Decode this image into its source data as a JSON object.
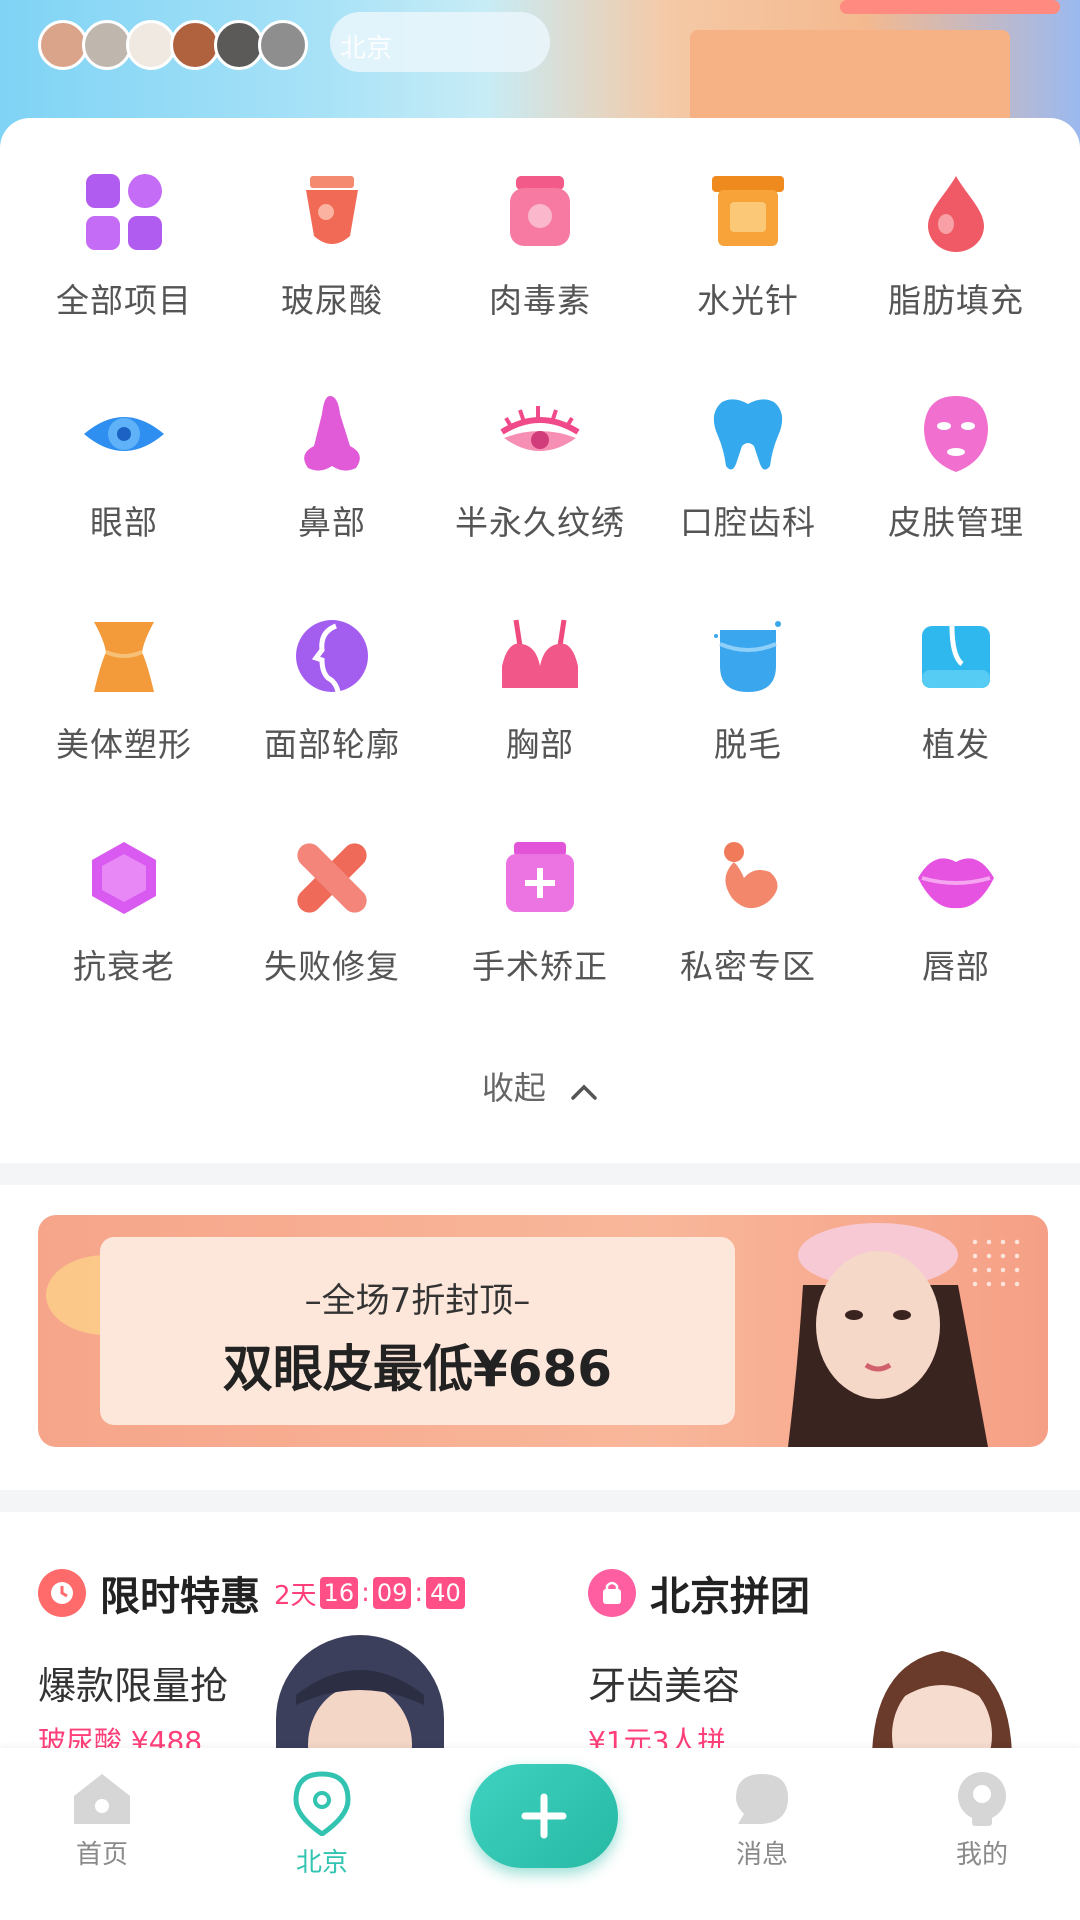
{
  "top_banner": {
    "cloud_text": "北京"
  },
  "categories": [
    {
      "label": "全部项目",
      "icon": "grid-icon"
    },
    {
      "label": "玻尿酸",
      "icon": "hyaluronic-vial-icon"
    },
    {
      "label": "肉毒素",
      "icon": "botox-jar-icon"
    },
    {
      "label": "水光针",
      "icon": "water-light-box-icon"
    },
    {
      "label": "脂肪填充",
      "icon": "fat-drop-icon"
    },
    {
      "label": "眼部",
      "icon": "eye-icon"
    },
    {
      "label": "鼻部",
      "icon": "nose-icon"
    },
    {
      "label": "半永久纹绣",
      "icon": "eyelash-icon"
    },
    {
      "label": "口腔齿科",
      "icon": "tooth-icon"
    },
    {
      "label": "皮肤管理",
      "icon": "face-mask-icon"
    },
    {
      "label": "美体塑形",
      "icon": "body-shape-icon"
    },
    {
      "label": "面部轮廓",
      "icon": "face-profile-icon"
    },
    {
      "label": "胸部",
      "icon": "bra-icon"
    },
    {
      "label": "脱毛",
      "icon": "hair-removal-icon"
    },
    {
      "label": "植发",
      "icon": "hair-implant-icon"
    },
    {
      "label": "抗衰老",
      "icon": "hexagon-gem-icon"
    },
    {
      "label": "失败修复",
      "icon": "bandage-icon"
    },
    {
      "label": "手术矫正",
      "icon": "correction-box-icon"
    },
    {
      "label": "私密专区",
      "icon": "private-care-icon"
    },
    {
      "label": "唇部",
      "icon": "lips-icon"
    }
  ],
  "collapse_label": "收起",
  "promo": {
    "subtitle": "–全场7折封顶–",
    "title": "双眼皮最低¥686"
  },
  "flash_sale": {
    "title": "限时特惠",
    "countdown_days": "2天",
    "countdown_h": "16",
    "countdown_m": "09",
    "countdown_s": "40",
    "subtitle": "爆款限量抢",
    "price_line": "玻尿酸 ¥488"
  },
  "group_buy": {
    "title": "北京拼团",
    "subtitle": "牙齿美容",
    "price_line": "¥1元3人拼"
  },
  "tabbar": {
    "home": "首页",
    "city": "北京",
    "messages": "消息",
    "mine": "我的"
  },
  "colors": {
    "accent_teal": "#32c3b1",
    "accent_pink": "#ff3f79"
  }
}
